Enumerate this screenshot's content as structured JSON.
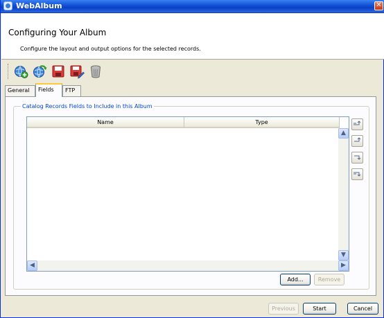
{
  "window": {
    "title": "WebAlbum",
    "close_glyph": "✕"
  },
  "header": {
    "title": "Configuring Your Album",
    "subtitle": "Configure the layout and output options for the selected records."
  },
  "toolbar": {
    "icons": [
      "globe-add-icon",
      "globe-refresh-icon",
      "save-icon",
      "save-as-icon",
      "trash-icon"
    ]
  },
  "tabs": [
    "General",
    "Fields",
    "FTP"
  ],
  "active_tab": "Fields",
  "fields_panel": {
    "legend": "Catalog Records Fields to Include in this Album",
    "columns": [
      "Name",
      "Type"
    ],
    "rows": [],
    "side_buttons": [
      "move-top-icon",
      "move-up-icon",
      "move-down-icon",
      "move-bottom-icon"
    ],
    "add_label": "Add...",
    "remove_label": "Remove"
  },
  "footer": {
    "previous_label": "Previous",
    "start_label": "Start",
    "cancel_label": "Cancel"
  },
  "colors": {
    "title_bar": "#0a42c8",
    "legend": "#0046d5",
    "active_tab_accent": "#ffc83c"
  }
}
